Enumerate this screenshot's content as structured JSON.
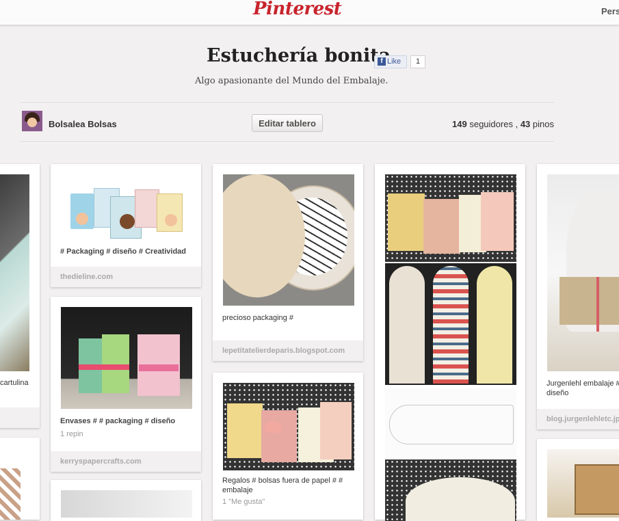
{
  "header": {
    "logo": "Pinterest",
    "right_text": "Pers"
  },
  "board": {
    "title": "Estuchería bonita",
    "like_label": "Like",
    "like_count": "1",
    "description": "Algo apasionante del Mundo del Embalaje."
  },
  "owner": {
    "name": "Bolsalea Bolsas",
    "edit_label": "Editar tablero"
  },
  "stats": {
    "followers": "149",
    "followers_label": "seguidores",
    "separator": ",",
    "pins": "43",
    "pins_label": "pinos"
  },
  "pins": {
    "col0_top": {
      "desc": "cartulina"
    },
    "col1_top": {
      "desc": "# Packaging # diseño # Creatividad",
      "source": "thedieline.com"
    },
    "col1_mid": {
      "desc": "Envases # # packaging # diseño",
      "meta": "1 repin",
      "source": "kerryspapercrafts.com"
    },
    "col2_top": {
      "desc": "precioso packaging #",
      "source": "lepetitatelierdeparis.blogspot.com"
    },
    "col2_mid": {
      "desc": "Regalos # bolsas fuera de papel # # embalaje",
      "meta": "1 \"Me gusta\""
    },
    "col4_top": {
      "desc": "Jurgenlehl embalaje # diseño",
      "source": "blog.jurgenlehletc.jp"
    }
  },
  "colors": {
    "brand": "#c8232c",
    "background": "#f2f0f0",
    "facebook": "#3b5998"
  }
}
